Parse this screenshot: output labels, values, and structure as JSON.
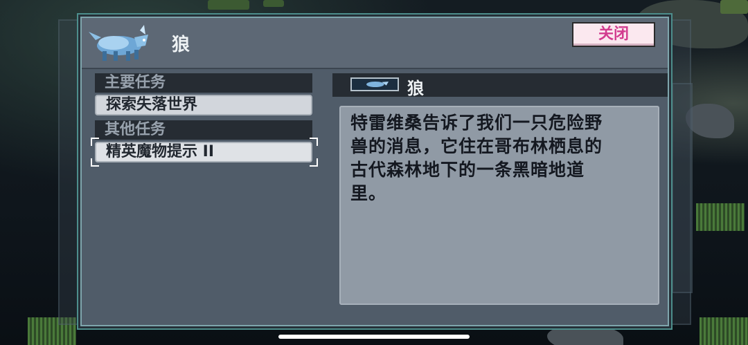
{
  "dialog": {
    "title": "狼",
    "close_label": "关闭"
  },
  "quests": {
    "main_header": "主要任务",
    "main_items": [
      {
        "label": "探索失落世界"
      }
    ],
    "other_header": "其他任务",
    "other_items": [
      {
        "label": "精英魔物提示 II",
        "selected": true
      }
    ]
  },
  "detail": {
    "title": "狼",
    "description": "特雷维桑告诉了我们一只危险野\n兽的消息，它住在哥布林栖息的\n古代森林地下的一条黑暗地道\n里。"
  },
  "colors": {
    "panel": "#505c69",
    "border_accent": "#4d8e8c",
    "close_text": "#d23c8f",
    "close_bg": "#fbe8ef"
  },
  "icons": {
    "portrait": "wolf-portrait-icon",
    "mini": "wolf-mini-icon"
  }
}
